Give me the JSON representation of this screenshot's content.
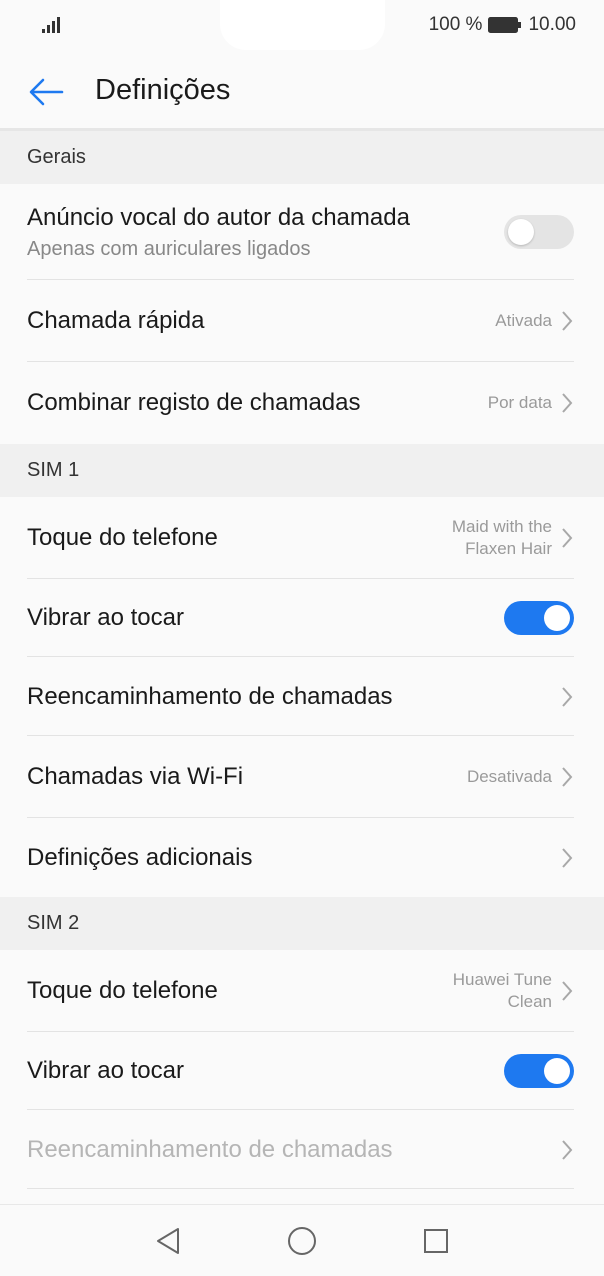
{
  "status_bar": {
    "battery_percent": "100 %",
    "time": "10.00",
    "battery_level": 1.0
  },
  "header": {
    "title": "Definições"
  },
  "sections": {
    "gerais": {
      "title": "Gerais",
      "anuncio": {
        "label": "Anúncio vocal do autor da chamada",
        "sub": "Apenas com auriculares ligados",
        "toggle": "off"
      },
      "chamada_rapida": {
        "label": "Chamada rápida",
        "value": "Ativada"
      },
      "combinar": {
        "label": "Combinar registo de chamadas",
        "value": "Por data"
      }
    },
    "sim1": {
      "title": "SIM 1",
      "toque": {
        "label": "Toque do telefone",
        "value_line1": "Maid with the",
        "value_line2": "Flaxen Hair"
      },
      "vibrar": {
        "label": "Vibrar ao tocar",
        "toggle": "on"
      },
      "reencaminhamento": {
        "label": "Reencaminhamento de chamadas"
      },
      "wifi": {
        "label": "Chamadas via Wi-Fi",
        "value": "Desativada"
      },
      "adicionais": {
        "label": "Definições adicionais"
      }
    },
    "sim2": {
      "title": "SIM 2",
      "toque": {
        "label": "Toque do telefone",
        "value_line1": "Huawei Tune",
        "value_line2": "Clean"
      },
      "vibrar": {
        "label": "Vibrar ao tocar",
        "toggle": "on"
      },
      "reencaminhamento": {
        "label": "Reencaminhamento de chamadas",
        "disabled": true
      }
    }
  },
  "icons": {
    "back": "arrow-left-icon",
    "chevron": "chevron-right-icon",
    "nav_back": "triangle-back-icon",
    "nav_home": "circle-home-icon",
    "nav_recents": "square-recents-icon"
  },
  "colors": {
    "accent": "#1e79f0",
    "toggle_off": "#e4e4e4",
    "section_bg": "#f0f0f0",
    "disabled_text": "#b5b5b5"
  }
}
